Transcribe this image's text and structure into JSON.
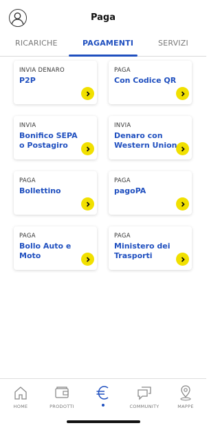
{
  "header": {
    "title": "Paga"
  },
  "tabs": [
    {
      "label": "RICARICHE"
    },
    {
      "label": "PAGAMENTI"
    },
    {
      "label": "SERVIZI"
    }
  ],
  "cards": [
    {
      "kicker": "INVIA DENARO",
      "title": "P2P"
    },
    {
      "kicker": "PAGA",
      "title": "Con Codice QR"
    },
    {
      "kicker": "INVIA",
      "title": "Bonifico SEPA o Postagiro"
    },
    {
      "kicker": "INVIA",
      "title": "Denaro con Western Union"
    },
    {
      "kicker": "PAGA",
      "title": "Bollettino"
    },
    {
      "kicker": "PAGA",
      "title": "pagoPA"
    },
    {
      "kicker": "PAGA",
      "title": "Bollo Auto e Moto"
    },
    {
      "kicker": "PAGA",
      "title": "Ministero dei Trasporti"
    }
  ],
  "nav": [
    {
      "label": "HOME",
      "icon": "home-icon"
    },
    {
      "label": "PRODOTTI",
      "icon": "wallet-icon"
    },
    {
      "label": "",
      "icon": "euro-icon",
      "active": true
    },
    {
      "label": "COMMUNITY",
      "icon": "chat-icon"
    },
    {
      "label": "MAPPE",
      "icon": "map-pin-icon"
    }
  ],
  "colors": {
    "accent": "#1f4fbf",
    "arrow_button": "#f1e000"
  }
}
